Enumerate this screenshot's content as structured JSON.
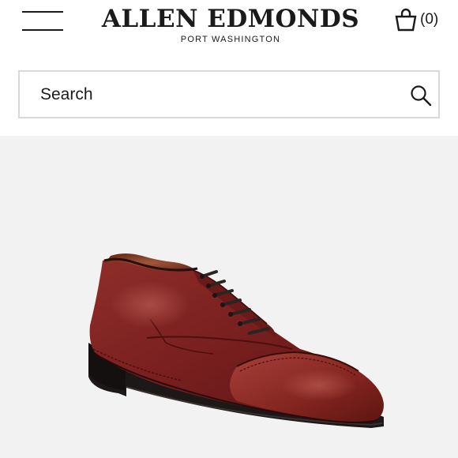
{
  "header": {
    "brand_name": "ALLEN EDMONDS",
    "brand_subtitle": "PORT WASHINGTON",
    "menu_icon": "hamburger-menu-icon",
    "cart_icon": "shopping-bag-icon",
    "cart_count": "(0)"
  },
  "search": {
    "placeholder": "Search",
    "icon": "search-icon"
  },
  "product": {
    "image": "burgundy cap-toe oxford dress shoe",
    "background_color": "#f2f2f2"
  },
  "colors": {
    "text": "#1a1a1a",
    "search_border": "#d8d8d8",
    "shoe_leather": "#7a2020"
  }
}
